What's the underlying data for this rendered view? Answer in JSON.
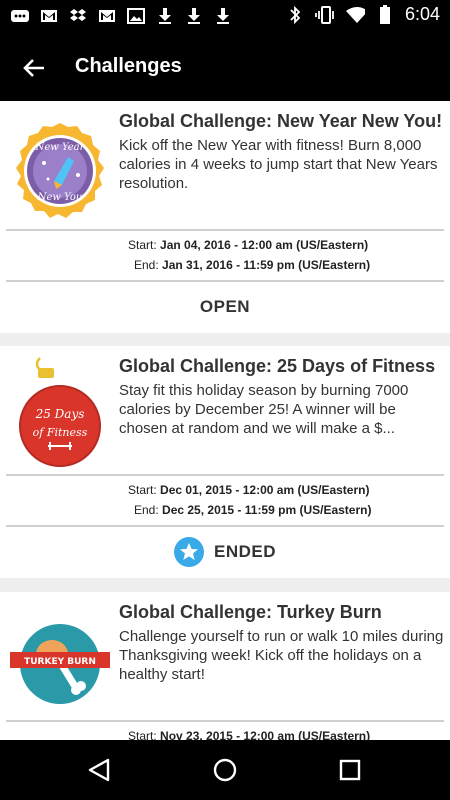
{
  "status_bar": {
    "time": "6:04",
    "icons_left": [
      "notification-icon",
      "gmail-icon",
      "dropbox-icon",
      "gmail-icon",
      "image-icon",
      "download-icon",
      "download-icon",
      "download-icon"
    ],
    "icons_right": [
      "bluetooth-icon",
      "vibrate-icon",
      "wifi-icon",
      "battery-icon"
    ]
  },
  "app_bar": {
    "title": "Challenges"
  },
  "challenges": [
    {
      "title": "Global Challenge: New Year New You!",
      "description": "Kick off the New Year with fitness! Burn 8,000 calories in 4 weeks to jump start that New Years resolution.",
      "badge_text_1": "New Year",
      "badge_text_2": "New You",
      "start_label": "Start:",
      "start_value": "Jan 04, 2016 - 12:00 am (US/Eastern)",
      "end_label": "End:",
      "end_value": "Jan 31, 2016 - 11:59 pm (US/Eastern)",
      "status": "OPEN"
    },
    {
      "title": "Global Challenge: 25 Days of Fitness",
      "description": "Stay fit this holiday season by burning 7000 calories by December 25! A winner will be chosen at random and we will make a $...",
      "badge_text_1": "25 Days",
      "badge_text_2": "of Fitness",
      "start_label": "Start:",
      "start_value": "Dec 01, 2015 - 12:00 am (US/Eastern)",
      "end_label": "End:",
      "end_value": "Dec 25, 2015 - 11:59 pm (US/Eastern)",
      "status": "ENDED"
    },
    {
      "title": "Global Challenge: Turkey Burn",
      "description": "Challenge yourself to run or walk 10 miles during Thanksgiving week! Kick off the holidays on a healthy start!",
      "badge_text_1": "TURKEY BURN",
      "start_label": "Start:",
      "start_value": "Nov 23, 2015 - 12:00 am (US/Eastern)"
    }
  ],
  "nav_bar": {
    "buttons": [
      "back-icon",
      "home-icon",
      "recents-icon"
    ]
  }
}
